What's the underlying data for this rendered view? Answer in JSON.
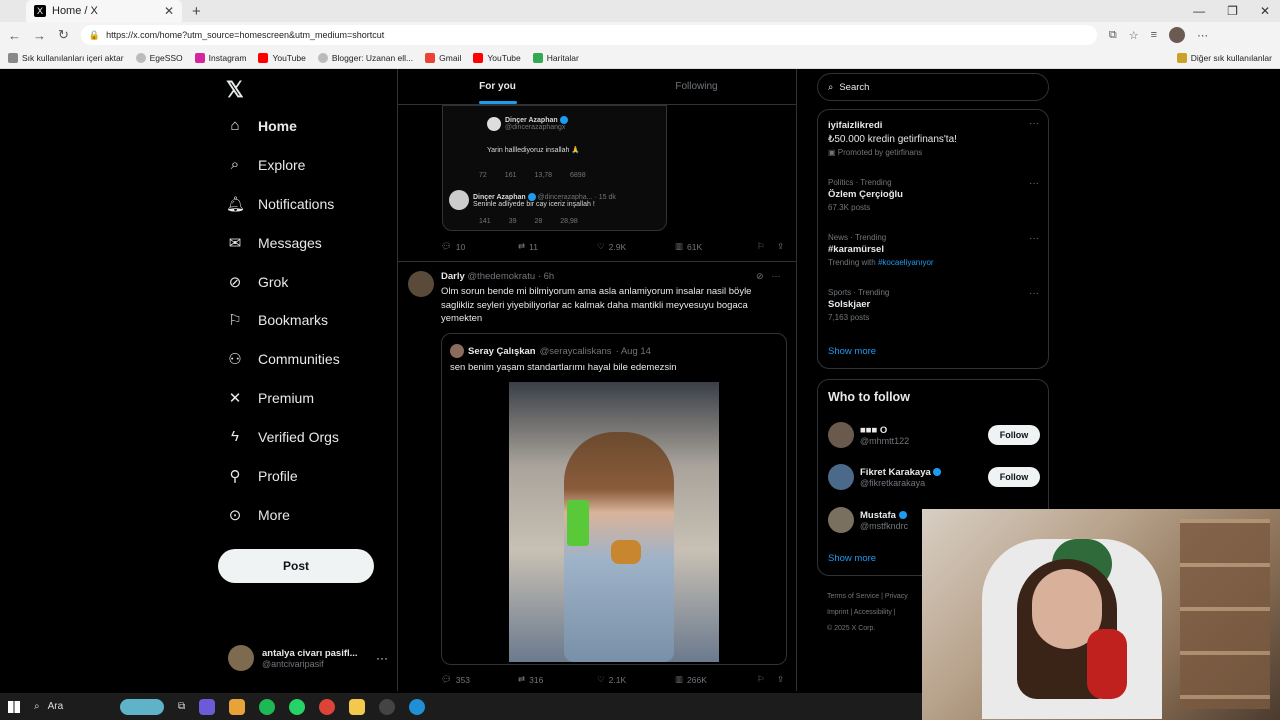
{
  "browser": {
    "tab_title": "Home / X",
    "url": "https://x.com/home?utm_source=homescreen&utm_medium=shortcut",
    "bookmarks": [
      "Sık kullanılanları içeri aktar",
      "EgeSSO",
      "Instagram",
      "YouTube",
      "Blogger: Uzanan ell...",
      "Gmail",
      "YouTube",
      "Haritalar"
    ],
    "bookmarks_right": "Diğer sık kullanılanlar"
  },
  "nav": {
    "items": [
      {
        "label": "Home",
        "icon": "home-icon"
      },
      {
        "label": "Explore",
        "icon": "search-icon"
      },
      {
        "label": "Notifications",
        "icon": "bell-icon"
      },
      {
        "label": "Messages",
        "icon": "mail-icon"
      },
      {
        "label": "Grok",
        "icon": "grok-icon"
      },
      {
        "label": "Bookmarks",
        "icon": "bookmark-icon"
      },
      {
        "label": "Communities",
        "icon": "people-icon"
      },
      {
        "label": "Premium",
        "icon": "x-icon"
      },
      {
        "label": "Verified Orgs",
        "icon": "lightning-icon"
      },
      {
        "label": "Profile",
        "icon": "person-icon"
      },
      {
        "label": "More",
        "icon": "more-icon"
      }
    ],
    "post_label": "Post",
    "account_name": "antalya civarı pasifl...",
    "account_handle": "@antcivaripasif"
  },
  "timeline": {
    "tabs": [
      "For you",
      "Following"
    ],
    "embed": {
      "top_name": "Dinçer Azaphan",
      "top_handle": "@dincerazaphangx",
      "top_text": "Yarin halllediyoruz insallah 🙏",
      "top_stats": [
        "72",
        "161",
        "13,78",
        "6898"
      ],
      "reply_name": "Dinçer Azaphan",
      "reply_handle": "@dincerazapha... · 15 dk",
      "reply_text": "Seninle adliyede bir cay iceriz inşallah !",
      "reply_stats": [
        "141",
        "39",
        "28",
        "28,98"
      ]
    },
    "tweet1_actions": {
      "replies": "10",
      "retweets": "11",
      "likes": "2.9K",
      "views": "61K"
    },
    "tweet2": {
      "name": "Darly",
      "handle": "@thedemokratu",
      "time": "· 6h",
      "text": "Olm sorun bende mi bilmiyorum ama asla anlamiyorum insalar nasil böyle saglikliz seyleri yiyebiliyorlar ac kalmak daha mantikli meyvesuyu bogaca yemekten",
      "quote_name": "Seray Çalışkan",
      "quote_handle": "@seraycaliskans",
      "quote_time": "· Aug 14",
      "quote_text": "sen benim yaşam standartlarımı hayal bile edemezsin",
      "actions": {
        "replies": "353",
        "retweets": "316",
        "likes": "2.1K",
        "views": "266K"
      }
    }
  },
  "sidebar": {
    "search_placeholder": "Search",
    "trends": [
      {
        "category": "",
        "name": "iyifaizlikredi",
        "promo": "₺50.000 kredin getirfinans'ta!",
        "sub": "Promoted by getirfinans"
      },
      {
        "category": "Politics · Trending",
        "name": "Özlem Çerçioğlu",
        "sub": "67.3K posts"
      },
      {
        "category": "News · Trending",
        "name": "#karamürsel",
        "sub_prefix": "Trending with",
        "sub_link": "#kocaeliyanıyor"
      },
      {
        "category": "Sports · Trending",
        "name": "Solskjaer",
        "sub": "7,163 posts"
      }
    ],
    "show_more": "Show more",
    "who_to_follow": "Who to follow",
    "follow_users": [
      {
        "name": "■■■ O",
        "handle": "@mhmtt122",
        "button": "Follow"
      },
      {
        "name": "Fikret Karakaya",
        "handle": "@fikretkarakaya",
        "button": "Follow"
      },
      {
        "name": "Mustafa",
        "handle": "@mstfkndrc",
        "button": ""
      }
    ],
    "footer_line1": "Terms of Service  |  Privacy",
    "footer_line2": "Imprint  |  Accessibility  |",
    "footer_line3": "© 2025 X Corp."
  },
  "taskbar": {
    "search_label": "Ara"
  }
}
